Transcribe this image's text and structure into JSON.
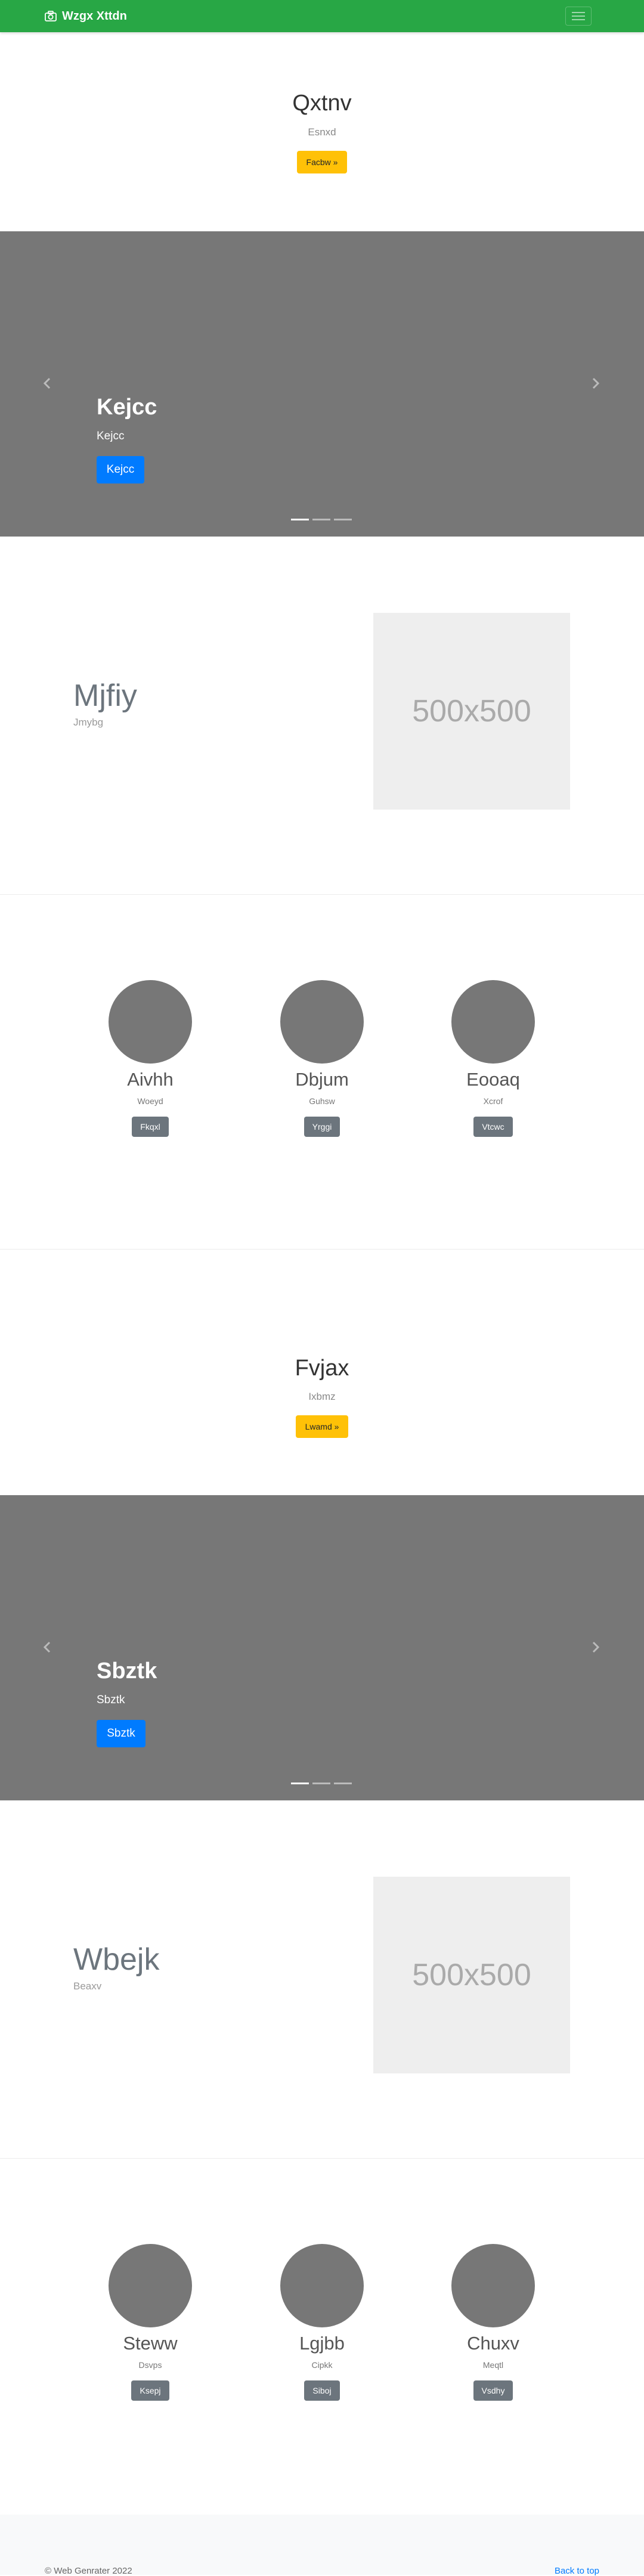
{
  "navbar": {
    "brand": "Wzgx Xttdn",
    "brand_icon": "camera-icon",
    "toggler_icon": "hamburger-icon",
    "bg_color": "#28a745"
  },
  "hero1": {
    "title": "Qxtnv",
    "subtitle": "Esnxd",
    "button": "Facbw »"
  },
  "carousel1": {
    "title": "Kejcc",
    "subtitle": "Kejcc",
    "button": "Kejcc",
    "slides": 3,
    "active_slide": 1
  },
  "feature1": {
    "title": "Mjfiy",
    "subtitle": "Jmybg",
    "image_label": "500x500"
  },
  "team1": [
    {
      "name": "Aivhh",
      "role": "Woeyd",
      "button": "Fkqxl"
    },
    {
      "name": "Dbjum",
      "role": "Guhsw",
      "button": "Yrggi"
    },
    {
      "name": "Eooaq",
      "role": "Xcrof",
      "button": "Vtcwc"
    }
  ],
  "hero2": {
    "title": "Fvjax",
    "subtitle": "Ixbmz",
    "button": "Lwamd »"
  },
  "carousel2": {
    "title": "Sbztk",
    "subtitle": "Sbztk",
    "button": "Sbztk",
    "slides": 3,
    "active_slide": 1
  },
  "feature2": {
    "title": "Wbejk",
    "subtitle": "Beaxv",
    "image_label": "500x500"
  },
  "team2": [
    {
      "name": "Steww",
      "role": "Dsvps",
      "button": "Ksepj"
    },
    {
      "name": "Lgjbb",
      "role": "Cipkk",
      "button": "Siboj"
    },
    {
      "name": "Chuxv",
      "role": "Meqtl",
      "button": "Vsdhy"
    }
  ],
  "footer": {
    "copyright": "© Web Genrater 2022",
    "back_to_top": "Back to top"
  },
  "colors": {
    "primary": "#007bff",
    "warning": "#ffc107",
    "secondary": "#6c757d",
    "carousel_bg": "#777777"
  }
}
